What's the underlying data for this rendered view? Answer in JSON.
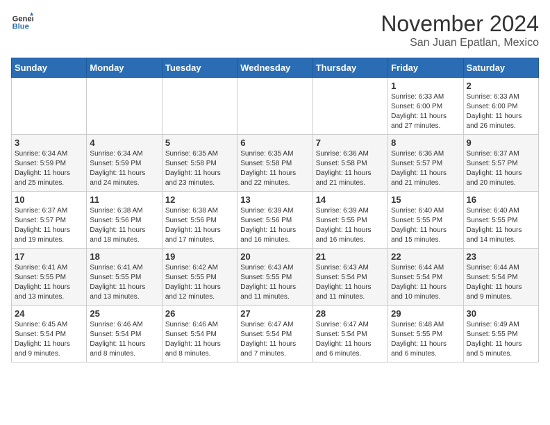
{
  "header": {
    "logo": {
      "line1": "General",
      "line2": "Blue"
    },
    "title": "November 2024",
    "subtitle": "San Juan Epatlan, Mexico"
  },
  "weekdays": [
    "Sunday",
    "Monday",
    "Tuesday",
    "Wednesday",
    "Thursday",
    "Friday",
    "Saturday"
  ],
  "weeks": [
    [
      {
        "day": "",
        "info": ""
      },
      {
        "day": "",
        "info": ""
      },
      {
        "day": "",
        "info": ""
      },
      {
        "day": "",
        "info": ""
      },
      {
        "day": "",
        "info": ""
      },
      {
        "day": "1",
        "info": "Sunrise: 6:33 AM\nSunset: 6:00 PM\nDaylight: 11 hours\nand 27 minutes."
      },
      {
        "day": "2",
        "info": "Sunrise: 6:33 AM\nSunset: 6:00 PM\nDaylight: 11 hours\nand 26 minutes."
      }
    ],
    [
      {
        "day": "3",
        "info": "Sunrise: 6:34 AM\nSunset: 5:59 PM\nDaylight: 11 hours\nand 25 minutes."
      },
      {
        "day": "4",
        "info": "Sunrise: 6:34 AM\nSunset: 5:59 PM\nDaylight: 11 hours\nand 24 minutes."
      },
      {
        "day": "5",
        "info": "Sunrise: 6:35 AM\nSunset: 5:58 PM\nDaylight: 11 hours\nand 23 minutes."
      },
      {
        "day": "6",
        "info": "Sunrise: 6:35 AM\nSunset: 5:58 PM\nDaylight: 11 hours\nand 22 minutes."
      },
      {
        "day": "7",
        "info": "Sunrise: 6:36 AM\nSunset: 5:58 PM\nDaylight: 11 hours\nand 21 minutes."
      },
      {
        "day": "8",
        "info": "Sunrise: 6:36 AM\nSunset: 5:57 PM\nDaylight: 11 hours\nand 21 minutes."
      },
      {
        "day": "9",
        "info": "Sunrise: 6:37 AM\nSunset: 5:57 PM\nDaylight: 11 hours\nand 20 minutes."
      }
    ],
    [
      {
        "day": "10",
        "info": "Sunrise: 6:37 AM\nSunset: 5:57 PM\nDaylight: 11 hours\nand 19 minutes."
      },
      {
        "day": "11",
        "info": "Sunrise: 6:38 AM\nSunset: 5:56 PM\nDaylight: 11 hours\nand 18 minutes."
      },
      {
        "day": "12",
        "info": "Sunrise: 6:38 AM\nSunset: 5:56 PM\nDaylight: 11 hours\nand 17 minutes."
      },
      {
        "day": "13",
        "info": "Sunrise: 6:39 AM\nSunset: 5:56 PM\nDaylight: 11 hours\nand 16 minutes."
      },
      {
        "day": "14",
        "info": "Sunrise: 6:39 AM\nSunset: 5:55 PM\nDaylight: 11 hours\nand 16 minutes."
      },
      {
        "day": "15",
        "info": "Sunrise: 6:40 AM\nSunset: 5:55 PM\nDaylight: 11 hours\nand 15 minutes."
      },
      {
        "day": "16",
        "info": "Sunrise: 6:40 AM\nSunset: 5:55 PM\nDaylight: 11 hours\nand 14 minutes."
      }
    ],
    [
      {
        "day": "17",
        "info": "Sunrise: 6:41 AM\nSunset: 5:55 PM\nDaylight: 11 hours\nand 13 minutes."
      },
      {
        "day": "18",
        "info": "Sunrise: 6:41 AM\nSunset: 5:55 PM\nDaylight: 11 hours\nand 13 minutes."
      },
      {
        "day": "19",
        "info": "Sunrise: 6:42 AM\nSunset: 5:55 PM\nDaylight: 11 hours\nand 12 minutes."
      },
      {
        "day": "20",
        "info": "Sunrise: 6:43 AM\nSunset: 5:55 PM\nDaylight: 11 hours\nand 11 minutes."
      },
      {
        "day": "21",
        "info": "Sunrise: 6:43 AM\nSunset: 5:54 PM\nDaylight: 11 hours\nand 11 minutes."
      },
      {
        "day": "22",
        "info": "Sunrise: 6:44 AM\nSunset: 5:54 PM\nDaylight: 11 hours\nand 10 minutes."
      },
      {
        "day": "23",
        "info": "Sunrise: 6:44 AM\nSunset: 5:54 PM\nDaylight: 11 hours\nand 9 minutes."
      }
    ],
    [
      {
        "day": "24",
        "info": "Sunrise: 6:45 AM\nSunset: 5:54 PM\nDaylight: 11 hours\nand 9 minutes."
      },
      {
        "day": "25",
        "info": "Sunrise: 6:46 AM\nSunset: 5:54 PM\nDaylight: 11 hours\nand 8 minutes."
      },
      {
        "day": "26",
        "info": "Sunrise: 6:46 AM\nSunset: 5:54 PM\nDaylight: 11 hours\nand 8 minutes."
      },
      {
        "day": "27",
        "info": "Sunrise: 6:47 AM\nSunset: 5:54 PM\nDaylight: 11 hours\nand 7 minutes."
      },
      {
        "day": "28",
        "info": "Sunrise: 6:47 AM\nSunset: 5:54 PM\nDaylight: 11 hours\nand 6 minutes."
      },
      {
        "day": "29",
        "info": "Sunrise: 6:48 AM\nSunset: 5:55 PM\nDaylight: 11 hours\nand 6 minutes."
      },
      {
        "day": "30",
        "info": "Sunrise: 6:49 AM\nSunset: 5:55 PM\nDaylight: 11 hours\nand 5 minutes."
      }
    ]
  ]
}
